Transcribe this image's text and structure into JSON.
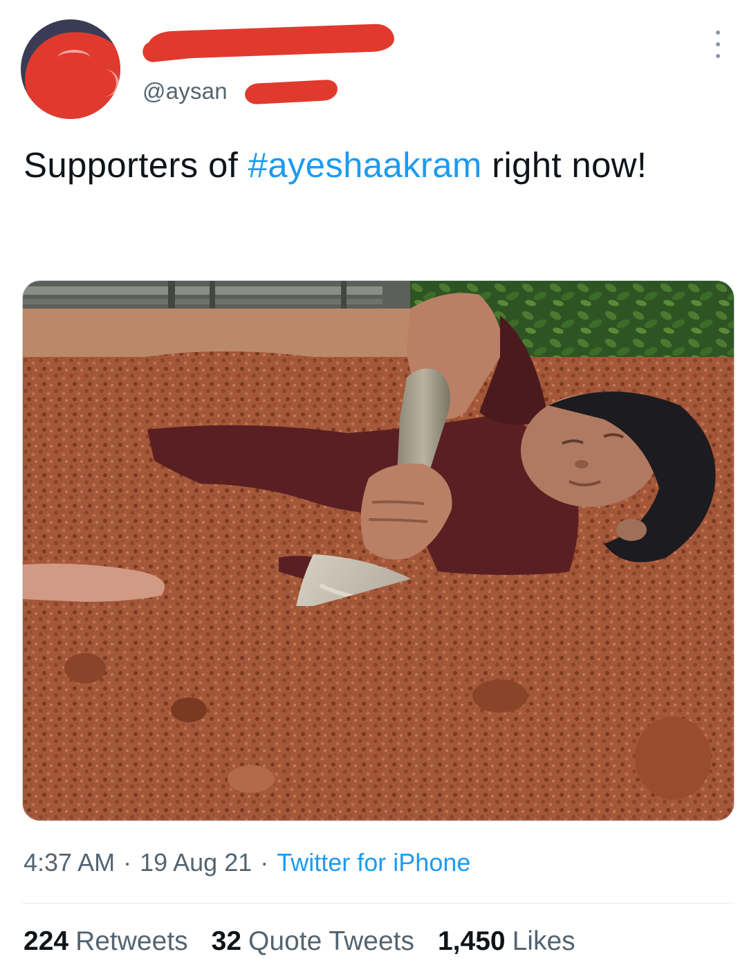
{
  "tweet": {
    "handle": "@aysan",
    "text_before": "Supporters of ",
    "hashtag": "#ayeshaakram",
    "text_after": " right now!",
    "time": "4:37 AM",
    "date": "19 Aug 21",
    "separator": "·",
    "source": "Twitter for iPhone"
  },
  "stats": {
    "retweets_count": "224",
    "retweets_label": "Retweets",
    "quote_count": "32",
    "quote_label": "Quote Tweets",
    "likes_count": "1,450",
    "likes_label": "Likes"
  },
  "colors": {
    "link": "#1d9bf0",
    "secondary_text": "#536471",
    "redaction": "#e03a2f"
  },
  "icons": {
    "more": "more-vertical-icon"
  }
}
